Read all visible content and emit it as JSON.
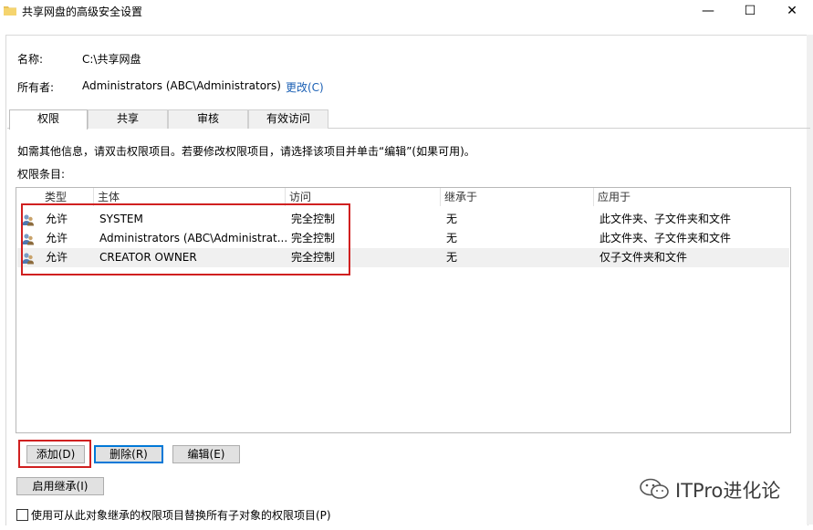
{
  "window": {
    "title": "共享网盘的高级安全设置",
    "minimize_glyph": "—",
    "maximize_glyph": "☐",
    "close_glyph": "✕"
  },
  "header": {
    "name_label": "名称:",
    "name_value": "C:\\共享网盘",
    "owner_label": "所有者:",
    "owner_value": "Administrators (ABC\\Administrators)",
    "change_link": "更改(C)"
  },
  "tabs": [
    {
      "label": "权限",
      "active": true
    },
    {
      "label": "共享",
      "active": false
    },
    {
      "label": "审核",
      "active": false
    },
    {
      "label": "有效访问",
      "active": false
    }
  ],
  "instructions": "如需其他信息，请双击权限项目。若要修改权限项目，请选择该项目并单击“编辑”(如果可用)。",
  "entries_label": "权限条目:",
  "table": {
    "columns": [
      "类型",
      "主体",
      "访问",
      "继承于",
      "应用于"
    ],
    "rows": [
      {
        "type": "允许",
        "principal": "SYSTEM",
        "access": "完全控制",
        "inherited": "无",
        "applies": "此文件夹、子文件夹和文件"
      },
      {
        "type": "允许",
        "principal": "Administrators (ABC\\Administrat...",
        "access": "完全控制",
        "inherited": "无",
        "applies": "此文件夹、子文件夹和文件"
      },
      {
        "type": "允许",
        "principal": "CREATOR OWNER",
        "access": "完全控制",
        "inherited": "无",
        "applies": "仅子文件夹和文件"
      }
    ]
  },
  "buttons": {
    "add": "添加(D)",
    "remove": "删除(R)",
    "edit": "编辑(E)",
    "enable_inheritance": "启用继承(I)"
  },
  "checkbox_label": "使用可从此对象继承的权限项目替换所有子对象的权限项目(P)",
  "watermark": "ITPro进化论",
  "colors": {
    "highlight_red": "#d02020",
    "link_blue": "#1a5fb4",
    "focus_blue": "#0078d7"
  }
}
